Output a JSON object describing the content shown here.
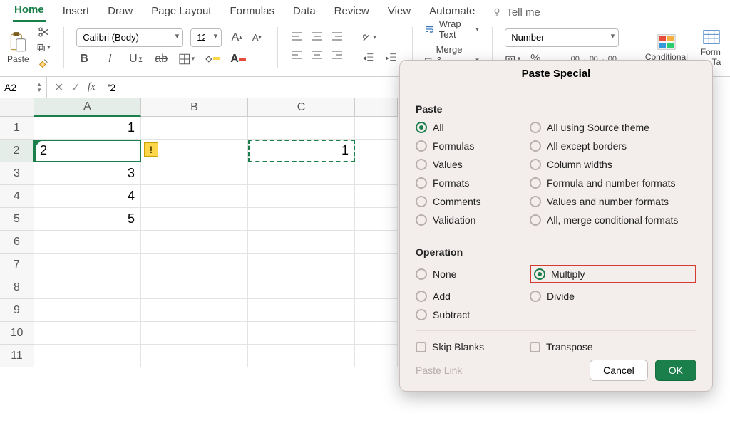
{
  "tabs": {
    "home": "Home",
    "insert": "Insert",
    "draw": "Draw",
    "pagelayout": "Page Layout",
    "formulas": "Formulas",
    "data": "Data",
    "review": "Review",
    "view": "View",
    "automate": "Automate",
    "tellme": "Tell me"
  },
  "toolbar": {
    "paste": "Paste",
    "font": "Calibri (Body)",
    "size": "12",
    "wrap": "Wrap Text",
    "merge": "Merge & Center",
    "numberformat": "Number",
    "conditional": "Conditional",
    "formatas": "Form as Ta"
  },
  "fx": {
    "cellref": "A2",
    "formula": "'2"
  },
  "cols": [
    "A",
    "B",
    "C"
  ],
  "rows": [
    "1",
    "2",
    "3",
    "4",
    "5",
    "6",
    "7",
    "8",
    "9",
    "10",
    "11"
  ],
  "cells": {
    "A1": "1",
    "A2": "2",
    "A3": "3",
    "A4": "4",
    "A5": "5",
    "C2": "1"
  },
  "dialog": {
    "title": "Paste Special",
    "section_paste": "Paste",
    "section_op": "Operation",
    "paste_opts": {
      "all": "All",
      "formulas": "Formulas",
      "values": "Values",
      "formats": "Formats",
      "comments": "Comments",
      "validation": "Validation",
      "source": "All using Source theme",
      "exceptb": "All except borders",
      "colw": "Column widths",
      "fnf": "Formula and number formats",
      "vnf": "Values and number formats",
      "merge": "All, merge conditional formats"
    },
    "op_opts": {
      "none": "None",
      "add": "Add",
      "subtract": "Subtract",
      "multiply": "Multiply",
      "divide": "Divide"
    },
    "skip": "Skip Blanks",
    "transpose": "Transpose",
    "pastelink": "Paste Link",
    "cancel": "Cancel",
    "ok": "OK"
  }
}
